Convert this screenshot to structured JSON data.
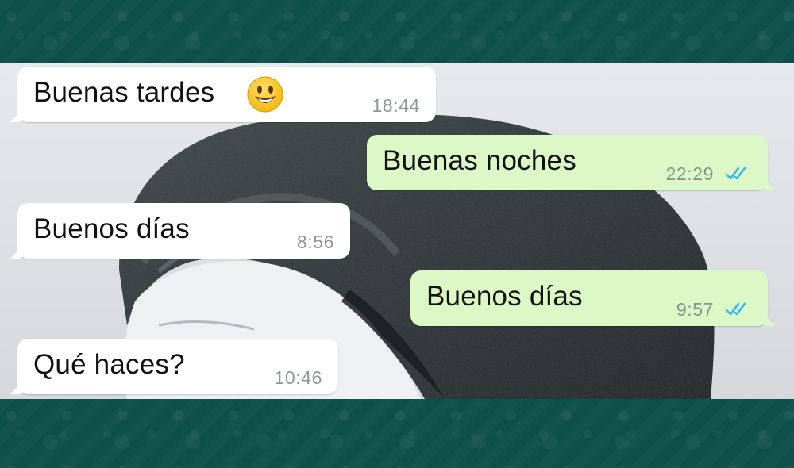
{
  "chat": {
    "messages": [
      {
        "direction": "incoming",
        "text": "Buenas tardes",
        "time": "18:44",
        "emoji": "smiley-emoji-icon"
      },
      {
        "direction": "outgoing",
        "text": "Buenas noches",
        "time": "22:29",
        "status": "read-double-check-icon"
      },
      {
        "direction": "incoming",
        "text": "Buenos días",
        "time": "8:56"
      },
      {
        "direction": "outgoing",
        "text": "Buenos días",
        "time": "9:57",
        "status": "read-double-check-icon"
      },
      {
        "direction": "incoming",
        "text": "Qué haces?",
        "time": "10:46"
      }
    ]
  },
  "colors": {
    "frame_band": "#0d5049",
    "incoming_bubble": "#ffffff",
    "outgoing_bubble": "#dcf8c6",
    "read_check": "#34b7f1",
    "timestamp": "#8f9599",
    "emoji_face": "#f9c22e"
  }
}
